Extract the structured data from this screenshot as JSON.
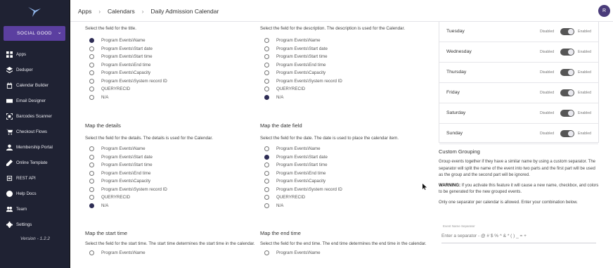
{
  "sidebar": {
    "org_label": "SOCIAL GOOD",
    "items": [
      {
        "label": "Apps",
        "icon": "grid-icon"
      },
      {
        "label": "Deduper",
        "icon": "layers-icon"
      },
      {
        "label": "Calendar Builder",
        "icon": "calendar-icon"
      },
      {
        "label": "Email Designer",
        "icon": "mail-icon"
      },
      {
        "label": "Barcodes Scanner",
        "icon": "scan-icon"
      },
      {
        "label": "Checkout Flows",
        "icon": "cart-icon"
      },
      {
        "label": "Membership Portal",
        "icon": "users-icon"
      },
      {
        "label": "Online Template",
        "icon": "pencil-icon"
      },
      {
        "label": "REST API",
        "icon": "code-icon"
      },
      {
        "label": "Help Docs",
        "icon": "help-icon"
      },
      {
        "label": "Team",
        "icon": "team-icon"
      },
      {
        "label": "Settings",
        "icon": "gear-icon"
      }
    ],
    "version": "Version - 1.2.2"
  },
  "header": {
    "breadcrumbs": [
      "Apps",
      "Calendars",
      "Daily Admission Calendar"
    ],
    "avatar_initial": "R"
  },
  "options_common": [
    "Program Events\\Name",
    "Program Events\\Start date",
    "Program Events\\Start time",
    "Program Events\\End time",
    "Program Events\\Capacity",
    "Program Events\\System record ID",
    "QUERYRECID",
    "N/A"
  ],
  "title_field": {
    "desc": "Select the field for the title.",
    "selected": 0
  },
  "description_field": {
    "desc": "Select the field for the description. The description is used for the Calendar.",
    "selected": 7
  },
  "details_field": {
    "title": "Map the details",
    "desc": "Select the field for the details. The details is used for the Calendar.",
    "selected": 7
  },
  "date_field": {
    "title": "Map the date field",
    "desc": "Select the field for the date. The date is used to place the calendar item.",
    "selected": 1
  },
  "start_time_field": {
    "title": "Map the start time",
    "desc": "Select the field for the start time. The start time determines the start time in the calendar.",
    "first_option": "Program Events\\Name"
  },
  "end_time_field": {
    "title": "Map the end time",
    "desc": "Select the field for the end time. The end time determines the end time in the calendar.",
    "first_option": "Program Events\\Name"
  },
  "days": {
    "disabled_label": "Disabled",
    "enabled_label": "Enabled",
    "items": [
      {
        "name": "Tuesday",
        "enabled": true
      },
      {
        "name": "Wednesday",
        "enabled": true
      },
      {
        "name": "Thursday",
        "enabled": true
      },
      {
        "name": "Friday",
        "enabled": true
      },
      {
        "name": "Saturday",
        "enabled": true
      },
      {
        "name": "Sunday",
        "enabled": true
      }
    ]
  },
  "custom_grouping": {
    "title": "Custom Grouping",
    "p1": "Group events together if they have a similar name by using a custom separator. The separator will split the name of the event into two parts and the first part will be used as the group and the second part will be ignored.",
    "warning_label": "WARNING:",
    "warning_text": " If you activate this feature it will cause a new name, checkbox, and colors to be generated for the new grouped events.",
    "p3": "Only one separator per calendar is allowed. Enter your combination below.",
    "separator_label": "Event Name Separator",
    "separator_placeholder": "Enter a separator - @ # $ % ^ & * ( ) _ = +"
  },
  "colors": {
    "sidebar_bg": "#1f2233",
    "accent": "#5b3fa0",
    "radio_selected": "#2e2d55"
  }
}
